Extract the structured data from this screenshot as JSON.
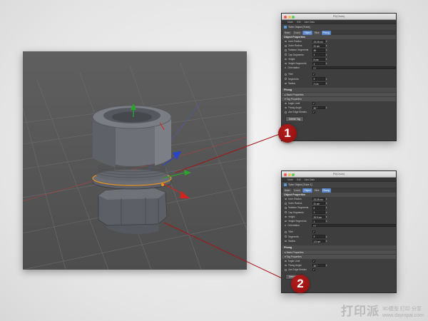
{
  "viewport": {
    "colors": {
      "grid": "#707070",
      "body": "#6b6e74",
      "axis_red": "#d2231e",
      "axis_green": "#2ca52c",
      "axis_blue": "#2645c9",
      "selection": "#e8931f"
    }
  },
  "panels": [
    {
      "window_title": "P0(Chutn)",
      "menus": [
        "Mode",
        "Edit",
        "User Data"
      ],
      "object_name": "Tube Object [Tube]",
      "tabs": [
        {
          "label": "Basic",
          "active": false
        },
        {
          "label": "Coord.",
          "active": false
        },
        {
          "label": "Object",
          "active": true
        },
        {
          "label": "Slice",
          "active": false
        },
        {
          "label": "Phong",
          "active": true
        }
      ],
      "section_title": "Object Properties",
      "fields": [
        {
          "label": "Inner Radius",
          "value": "23.25 cm"
        },
        {
          "label": "Outer Radius",
          "value": "31 cm"
        },
        {
          "label": "Rotation Segments",
          "value": "36"
        },
        {
          "label": "Cap Segments",
          "value": "1"
        },
        {
          "label": "Height",
          "value": "8 cm"
        },
        {
          "label": "Height Segments",
          "value": "1"
        },
        {
          "label": "Orientation",
          "value": "+Y",
          "wide": true
        }
      ],
      "fillet_fields": [
        {
          "label": "Fillet",
          "value": "✓",
          "check": true
        },
        {
          "label": "Segments",
          "value": "3"
        },
        {
          "label": "Radius",
          "value": "2 cm"
        }
      ],
      "phong_title": "Phong",
      "phong_subsections": [
        "▸ Basic Properties",
        "▾ Tag Properties"
      ],
      "phong_fields": [
        {
          "label": "Angle Limit",
          "value": "✓",
          "check": true
        },
        {
          "label": "Phong Angle",
          "value": "30 °"
        },
        {
          "label": "Use Edge Breaks",
          "value": "✓",
          "check": true
        }
      ],
      "button": "Delete Tag"
    },
    {
      "window_title": "P0(Chutn)",
      "menus": [
        "Mode",
        "Edit",
        "User Data"
      ],
      "object_name": "Tube Object [Tube.1]",
      "tabs": [
        {
          "label": "Basic",
          "active": false
        },
        {
          "label": "Coord.",
          "active": false
        },
        {
          "label": "Object",
          "active": true
        },
        {
          "label": "Slice",
          "active": false
        },
        {
          "label": "Phong",
          "active": true
        }
      ],
      "section_title": "Object Properties",
      "fields": [
        {
          "label": "Inner Radius",
          "value": "23.25 cm"
        },
        {
          "label": "Outer Radius",
          "value": "31 cm"
        },
        {
          "label": "Rotation Segments",
          "value": "6"
        },
        {
          "label": "Cap Segments",
          "value": "1"
        },
        {
          "label": "Height",
          "value": "26.5 cm"
        },
        {
          "label": "Height Segments",
          "value": "1"
        },
        {
          "label": "Orientation",
          "value": "+Y",
          "wide": true
        }
      ],
      "fillet_fields": [
        {
          "label": "Fillet",
          "value": "✓",
          "check": true
        },
        {
          "label": "Segments",
          "value": "3"
        },
        {
          "label": "Radius",
          "value": "1.5 cm"
        }
      ],
      "phong_title": "Phong",
      "phong_subsections": [
        "▸ Basic Properties",
        "▾ Tag Properties"
      ],
      "phong_fields": [
        {
          "label": "Angle Limit",
          "value": "✓",
          "check": true
        },
        {
          "label": "Phong Angle",
          "value": "30 °"
        },
        {
          "label": "Use Edge Breaks",
          "value": "✓",
          "check": true
        }
      ],
      "button": "Delete Tag"
    }
  ],
  "callouts": [
    {
      "number": "1",
      "color": "#a51515"
    },
    {
      "number": "2",
      "color": "#a51515"
    }
  ],
  "watermark": {
    "main": "打印派",
    "sub_cn": "3D模型 打印 分享",
    "sub_en": "www.dayinpai.com"
  }
}
